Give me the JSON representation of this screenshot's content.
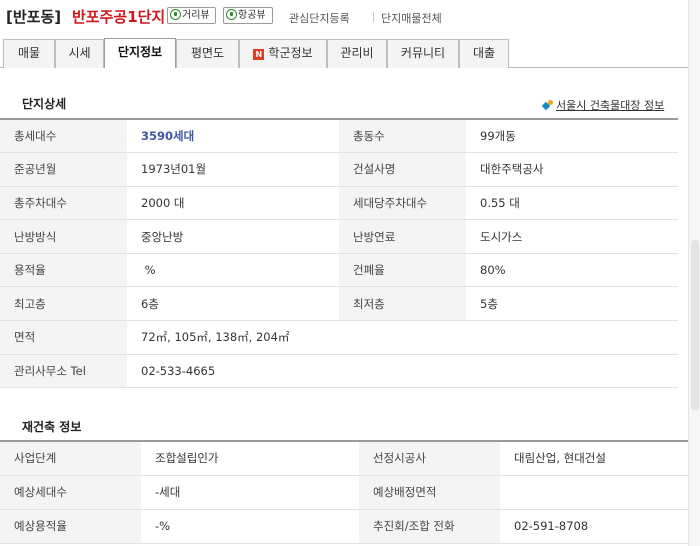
{
  "header": {
    "region": "[반포동]",
    "complex_name": "반포주공1단지",
    "street_view_label": "거리뷰",
    "aerial_view_label": "항공뷰",
    "favorite_label": "관심단지등록",
    "listings_label": "단지매물전체"
  },
  "tabs": [
    {
      "label": "매물"
    },
    {
      "label": "시세"
    },
    {
      "label": "단지정보",
      "active": true
    },
    {
      "label": "평면도"
    },
    {
      "label": "학군정보",
      "badge": "N"
    },
    {
      "label": "관리비"
    },
    {
      "label": "커뮤니티"
    },
    {
      "label": "대출"
    }
  ],
  "detail": {
    "title": "단지상세",
    "external_link": "서울시 건축물대장 정보",
    "rows": [
      [
        "총세대수",
        "3590세대",
        "총동수",
        "99개동"
      ],
      [
        "준공년월",
        "1973년01월",
        "건설사명",
        "대한주택공사"
      ],
      [
        "총주차대수",
        "2000 대",
        "세대당주차대수",
        "0.55 대"
      ],
      [
        "난방방식",
        "중앙난방",
        "난방연료",
        "도시가스"
      ],
      [
        "용적율",
        " %",
        "건폐율",
        "80%"
      ],
      [
        "최고층",
        "6층",
        "최저층",
        "5층"
      ]
    ],
    "area_label": "면적",
    "area_value": "72㎡, 105㎡, 138㎡, 204㎡",
    "office_label": "관리사무소 Tel",
    "office_value": "02-533-4665"
  },
  "rebuild": {
    "title": "재건축 정보",
    "rows": [
      [
        "사업단계",
        "조합설립인가",
        "선정시공사",
        "대림산업, 현대건설"
      ],
      [
        "예상세대수",
        "-세대",
        "예상배정면적",
        ""
      ],
      [
        "예상용적율",
        "-%",
        "추진회/조합 전화",
        "02-591-8708"
      ]
    ]
  },
  "colors": {
    "complex_name": "#d2151b",
    "highlight_value": "#3d57a6",
    "label_bg": "#f4f4f4"
  }
}
